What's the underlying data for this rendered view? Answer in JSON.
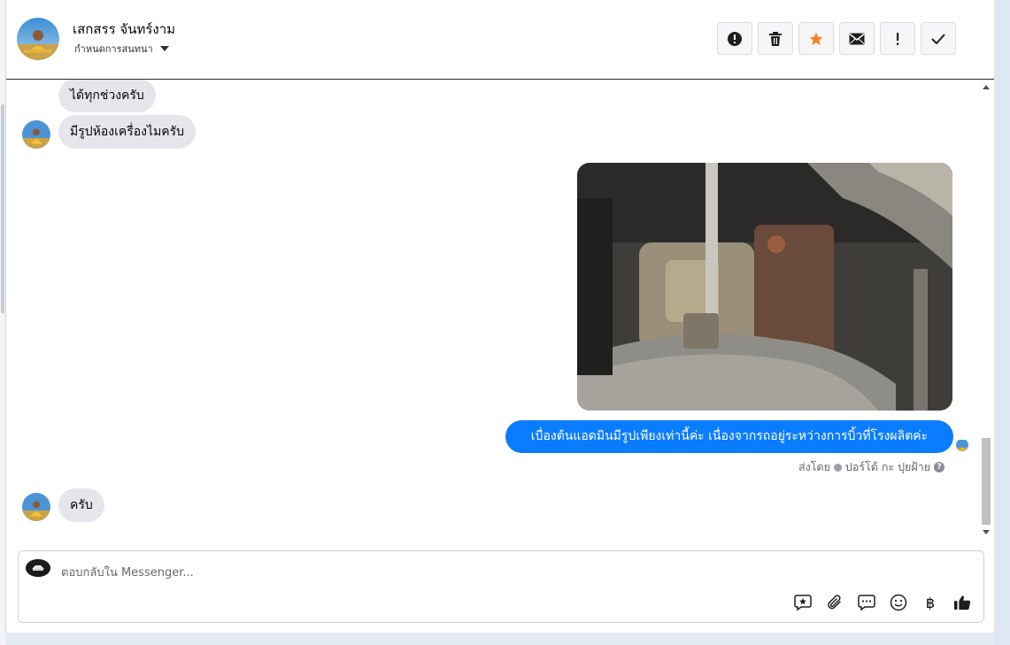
{
  "header": {
    "contact_name": "เสกสรร จันทร์งาม",
    "subtitle": "กำหนดการสนทนา",
    "toolbar": [
      {
        "name": "spam-button",
        "icon": "exclamation-circle-icon"
      },
      {
        "name": "delete-button",
        "icon": "trash-icon"
      },
      {
        "name": "star-button",
        "icon": "star-icon",
        "color": "#f5822a"
      },
      {
        "name": "mark-unread-button",
        "icon": "envelope-icon"
      },
      {
        "name": "follow-up-button",
        "icon": "exclamation-icon"
      },
      {
        "name": "done-button",
        "icon": "check-icon"
      }
    ]
  },
  "messages": {
    "m1": "ได้ทุกช่วงครับ",
    "m2": "มีรูปห้องเครื่องไมครับ",
    "outgoing": "เบื่องต้นแอดมินมีรูปเพียงเท่านี้ค่ะ เนื่องจากรถอยู่ระหว่างการบิ้วที่โรงผลิตค่ะ",
    "sent_by_prefix": "ส่งโดย",
    "sent_by_name": "ปอร์โต้ กะ ปุยฝ้าย",
    "m3": "ครับ"
  },
  "composer": {
    "placeholder": "ตอบกลับใน Messenger...",
    "tools": [
      "sticker-icon",
      "paperclip-icon",
      "saved-reply-icon",
      "emoji-icon",
      "baht-icon",
      "thumbs-up-icon"
    ],
    "baht_symbol": "฿"
  },
  "colors": {
    "outgoing_bubble": "#0a7cff",
    "incoming_bubble": "#e4e6eb",
    "star": "#f5822a"
  }
}
